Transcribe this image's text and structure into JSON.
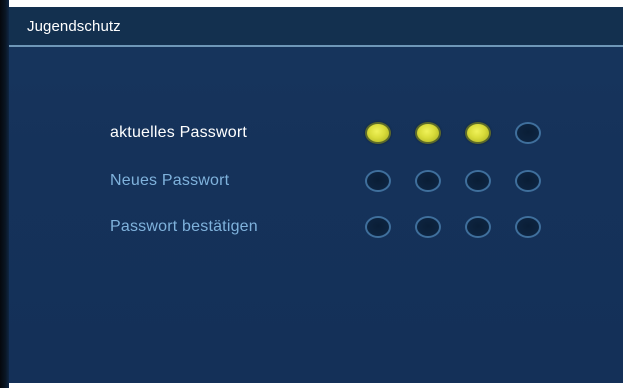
{
  "header": {
    "title": "Jugendschutz"
  },
  "rows": [
    {
      "label": "aktuelles Passwort",
      "state": "active",
      "digits_entered": 3,
      "digits_total": 4
    },
    {
      "label": "Neues Passwort",
      "state": "inactive",
      "digits_entered": 0,
      "digits_total": 4
    },
    {
      "label": "Passwort bestätigen",
      "state": "inactive",
      "digits_entered": 0,
      "digits_total": 4
    }
  ],
  "colors": {
    "background": "#15325a",
    "header_line": "#6e97b8",
    "active_label": "#ffffff",
    "inactive_label": "#7fb2dc",
    "filled_dot": "#d9dc3a",
    "empty_dot_border": "#3f6f9c"
  }
}
